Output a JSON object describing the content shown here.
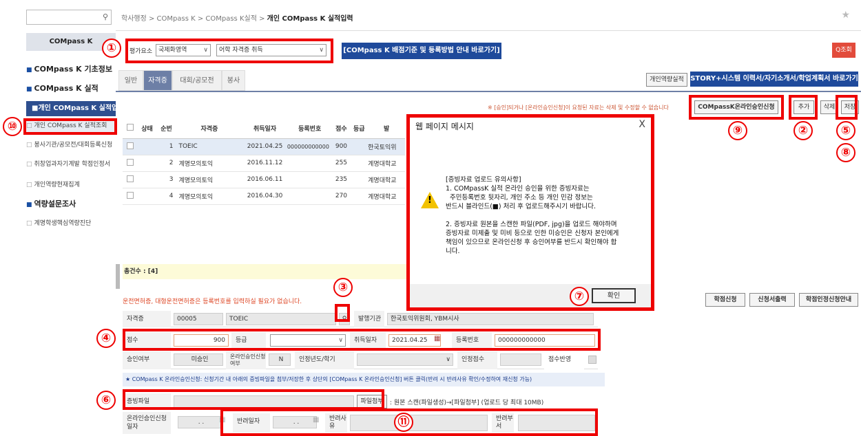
{
  "sidebar": {
    "search_icon": "search-icon",
    "title": "COMpass K",
    "items": [
      {
        "label": "COMpass K 기초정보",
        "type": "main"
      },
      {
        "label": "COMpass K 실적",
        "type": "main"
      },
      {
        "label": "개인 COMpass K 실적입력",
        "type": "active"
      },
      {
        "label": "개인 COMpass K 실적조회",
        "type": "sub"
      },
      {
        "label": "봉사기관/공모전/대회등록신청",
        "type": "sub"
      },
      {
        "label": "취창업과자기계발 학점인정서",
        "type": "sub"
      },
      {
        "label": "개인역량현재집계",
        "type": "sub"
      },
      {
        "label": "역량설문조사",
        "type": "main"
      },
      {
        "label": "계명학생핵심역량진단",
        "type": "sub"
      }
    ]
  },
  "breadcrumb": {
    "path": "학사행정 > COMpass K > COMpass K실적 > ",
    "current": "개인 COMpass K 실적입력"
  },
  "filter": {
    "label": "평가요소",
    "select1": "국제화영역",
    "select2": "어학 자격증 취득",
    "guide_button": "[COMpass K 배점기준 및 등록방법 안내 바로가기]",
    "query_button": "Q조회"
  },
  "tabs": [
    "일반",
    "자격증",
    "대회/공모전",
    "봉사"
  ],
  "top_buttons": {
    "personal": "개인역량실적",
    "story": "STORY+시스템 이력서/자기소개서/학업계획서 바로가기"
  },
  "notice": "※ [승인]되거나 [온라인승인신청]이 요청된 자료는 삭제 및 수정할 수 없습니다",
  "action_buttons": {
    "online": "COMpassK온라인승인신청",
    "add": "추가",
    "delete": "삭제",
    "save": "저장"
  },
  "grid": {
    "headers": [
      "상태",
      "순번",
      "자격증",
      "취득일자",
      "등록번호",
      "점수",
      "등급",
      "발"
    ],
    "rows": [
      [
        "",
        "1",
        "TOEIC",
        "2021.04.25",
        "000000000000",
        "900",
        "",
        "한국토익위"
      ],
      [
        "",
        "2",
        "계명모의토익",
        "2016.11.12",
        "",
        "255",
        "",
        "계명대학교"
      ],
      [
        "",
        "3",
        "계명모의토익",
        "2016.06.11",
        "",
        "235",
        "",
        "계명대학교"
      ],
      [
        "",
        "4",
        "계명모의토익",
        "2016.04.30",
        "",
        "270",
        "",
        "계명대학교"
      ]
    ],
    "total": "총건수 : [4]"
  },
  "form": {
    "warning": "운전면허증, 대형운전면허증은 등록번호를 입력하실 필요가 없습니다.",
    "cert_label": "자격증",
    "cert_code": "00005",
    "cert_name": "TOEIC",
    "issuer_label": "발행기관",
    "issuer": "한국토익위원회, YBM시사",
    "score_label": "점수",
    "score": "900",
    "grade_label": "등급",
    "grade": "",
    "date_label": "취득일자",
    "date": "2021.04.25",
    "regno_label": "등록번호",
    "regno": "000000000000",
    "approve_label": "승인여부",
    "approve": "미승인",
    "online_label": "온라인승인신청여부",
    "online": "N",
    "year_label": "인정년도/학기",
    "credit_label": "인정점수",
    "reflect_label": "점수반영",
    "info_line": "★ COMpass K 온라인승인신청: 신청기간 내 아래의 증빙파일을 첨부/저장한 후 상단의 [COMpass K 온라인승인신청] 버튼 클릭(반려 시 반려사유 확인/수정하여 재신청 가능)",
    "file_label": "증빙파일",
    "file_button": "파일첨부",
    "file_hint": ": 원본 스캔(파일생성)→[파일첨부] (업로드 당 최대 10MB)",
    "online_date_label": "온라인승인신청일자",
    "dots": ". .",
    "reject_date_label": "반려일자",
    "reject_reason_label": "반려사유",
    "reject_dept_label": "반려부서"
  },
  "right_buttons": {
    "credit": "학점신청",
    "print": "신청서출력",
    "guide": "학점인정신청안내"
  },
  "dialog": {
    "title": "웹 페이지 메시지",
    "close": "X",
    "lines": [
      "[증빙자료 업로드 유의사항]",
      "1. COMpassK 실적 온라인 승인을 위한 증빙자료는",
      "   주민등록번호 뒷자리, 개인 주소 등 개인 민감 정보는",
      "   반드시 블라인드(■) 처리 후 업로드해주시기 바랍니다.",
      "",
      "2. 증빙자료 원본을 스캔한 파일(PDF, jpg)을 업로드 해야하며",
      "증빙자료 미제출 및 미비 등으로 인한 미승인은 신청자 본인에게",
      "책임이 있으므로 온라인신청 후 승인여부를 반드시 확인해야 합",
      "니다."
    ],
    "ok": "확인"
  },
  "markers": [
    "①",
    "②",
    "③",
    "④",
    "⑤",
    "⑥",
    "⑦",
    "⑧",
    "⑨",
    "⑩",
    "⑪"
  ]
}
